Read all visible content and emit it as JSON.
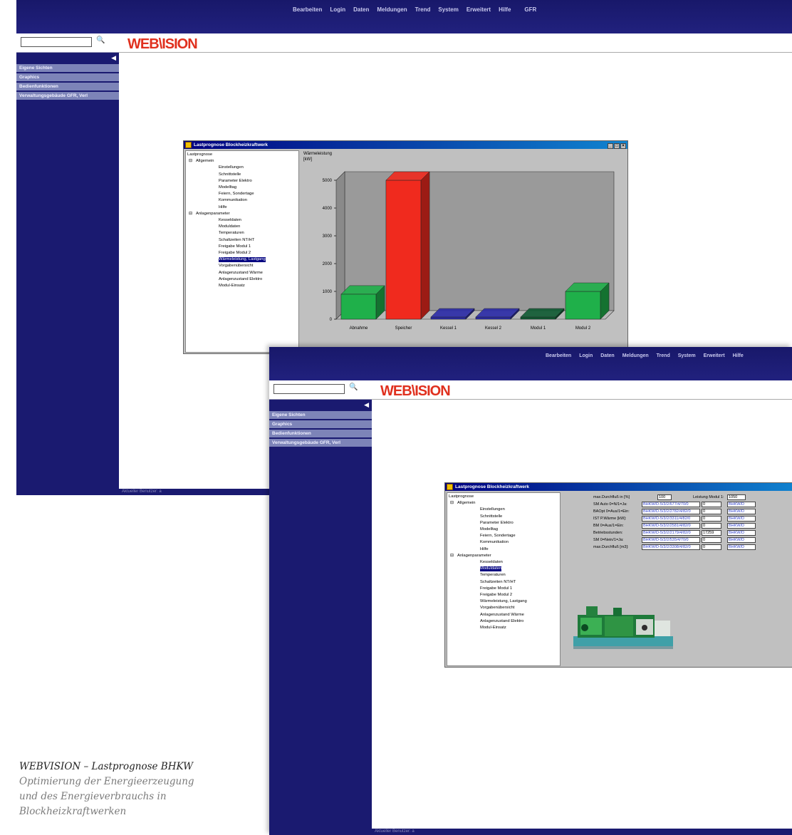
{
  "app": {
    "menu": [
      "Bearbeiten",
      "Login",
      "Daten",
      "Meldungen",
      "Trend",
      "System",
      "Erweitert",
      "Hilfe",
      "GFR"
    ],
    "logo": "WEB\\ISION",
    "sidebar_items": [
      "Eigene Sichten",
      "Graphics",
      "Bedienfunktionen",
      "Verwaltungsgebäude GFR, Verl"
    ],
    "status": "Aktueller Benutzer: a"
  },
  "window": {
    "title": "Lastprognose Blockheizkraftwerk"
  },
  "tree": {
    "root": "Lastprognose",
    "group1": "Allgemein",
    "group1_items": [
      "Einstellungen",
      "Schnittstelle",
      "Parameter Elektro",
      "Modelltag",
      "Feiern, Sondertage",
      "Kommunikation",
      "Hilfe"
    ],
    "group2": "Anlagenparameter",
    "group2_items": [
      "Kesseldaten",
      "Moduldaten",
      "Temperaturen",
      "Schaltzeiten NT/HT",
      "Freigabe Modul 1",
      "Freigabe Modul 2",
      "Wärmeleistung, Lastgang",
      "Vorgabenübersicht",
      "Anlagenzustand Wärme",
      "Anlagenzustand Elektro",
      "Modul-Einsatz"
    ]
  },
  "chart_data": {
    "type": "bar",
    "title": "Wärmeleistung",
    "ylabel": "[kW]",
    "categories": [
      "Abnahme",
      "Speicher",
      "Kessel 1",
      "Kessel 2",
      "Modul 1",
      "Modul 2"
    ],
    "values": [
      900,
      5000,
      0,
      0,
      0,
      1000
    ],
    "colors": [
      "#1fb04a",
      "#f02a1e",
      "#2b2ba8",
      "#2b2ba8",
      "#0f5a32",
      "#1fb04a"
    ],
    "ylim": [
      0,
      5000
    ],
    "yticks": [
      0,
      1000,
      2000,
      3000,
      4000,
      5000
    ]
  },
  "form": {
    "maxflow_label": "max.Durchfluß in [%]",
    "maxflow_value": "100",
    "power_label": "Leistung Modul 1:",
    "power_value": "1050",
    "rows": [
      {
        "label": "SM Auto 0=N/1=Ja:",
        "link": "BHKW/D-5/3/2/677/4/70/0",
        "value": "0"
      },
      {
        "label": "BAOpt 0=Aus/1=Ein:",
        "link": "BHKW/D-5/3/2/2782/4/82/0",
        "value": "0"
      },
      {
        "label": "IST P.Wärme [kW]:",
        "link": "BHKW/D-5/3/2/3311/4/82/0",
        "value": "0"
      },
      {
        "label": "BM 0=Aus/1=Ein:",
        "link": "BHKW/D-5/3/2/2581/4/82/0",
        "value": "0"
      },
      {
        "label": "Betriebsstunden:",
        "link": "BHKW/D-5/3/2/2179/4/82/0",
        "value": "17259"
      },
      {
        "label": "SM 0=Nein/1=Ja:",
        "link": "BHKW/D-5/3/2/535/4/70/0",
        "value": "0"
      },
      {
        "label": "max.Durchfluß [m3]:",
        "link": "BHKW/D-5/3/2/3308/4/82/0",
        "value": "0"
      }
    ],
    "right_link": "BHKW/D"
  },
  "caption": {
    "heading": "WEBVISION – Lastprognose BHKW",
    "line1": "Optimierung der Energieerzeugung",
    "line2": "und des Energieverbrauchs in",
    "line3": "Blockheizkraftwerken"
  }
}
